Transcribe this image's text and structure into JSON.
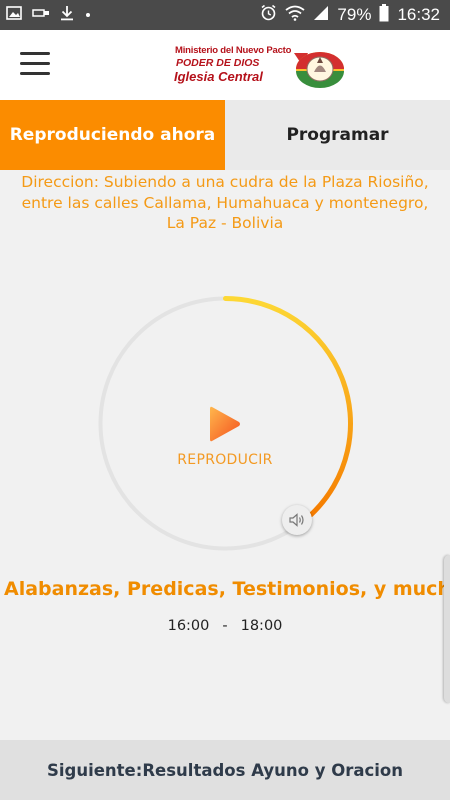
{
  "status_bar": {
    "battery": "79%",
    "time": "16:32",
    "left_icons": [
      "image-icon",
      "usb-icon",
      "download-icon",
      "dot-icon"
    ],
    "right_icons": [
      "alarm-icon",
      "wifi-icon",
      "signal-icon",
      "battery-icon"
    ]
  },
  "header": {
    "menu_icon": "hamburger-menu-icon",
    "logo": {
      "line1": "Ministerio del Nuevo Pacto",
      "line2": "PODER DE DIOS",
      "line3": "Iglesia Central"
    }
  },
  "tabs": [
    {
      "label": "Reproduciendo ahora",
      "active": true
    },
    {
      "label": "Programar",
      "active": false
    }
  ],
  "address": {
    "line1": "Direccion: Subiendo a una cudra de la Plaza Riosiño,",
    "line2": "entre las calles Callama, Humahuaca y montenegro,",
    "line3": "La Paz - Bolivia"
  },
  "player": {
    "play_label": "REPRODUCIR",
    "progress_fraction": 0.38,
    "volume_icon": "speaker-icon"
  },
  "program": {
    "title": "Alabanzas, Predicas, Testimonios, y mucho más...",
    "start": "16:00",
    "separator": "-",
    "end": "18:00"
  },
  "footer": {
    "next_text": "Siguiente:Resultados Ayuno y Oracion"
  },
  "colors": {
    "accent": "#fb8c00",
    "progress_start": "#fdd835",
    "progress_end": "#f57c00",
    "text_orange": "#f49a16"
  }
}
